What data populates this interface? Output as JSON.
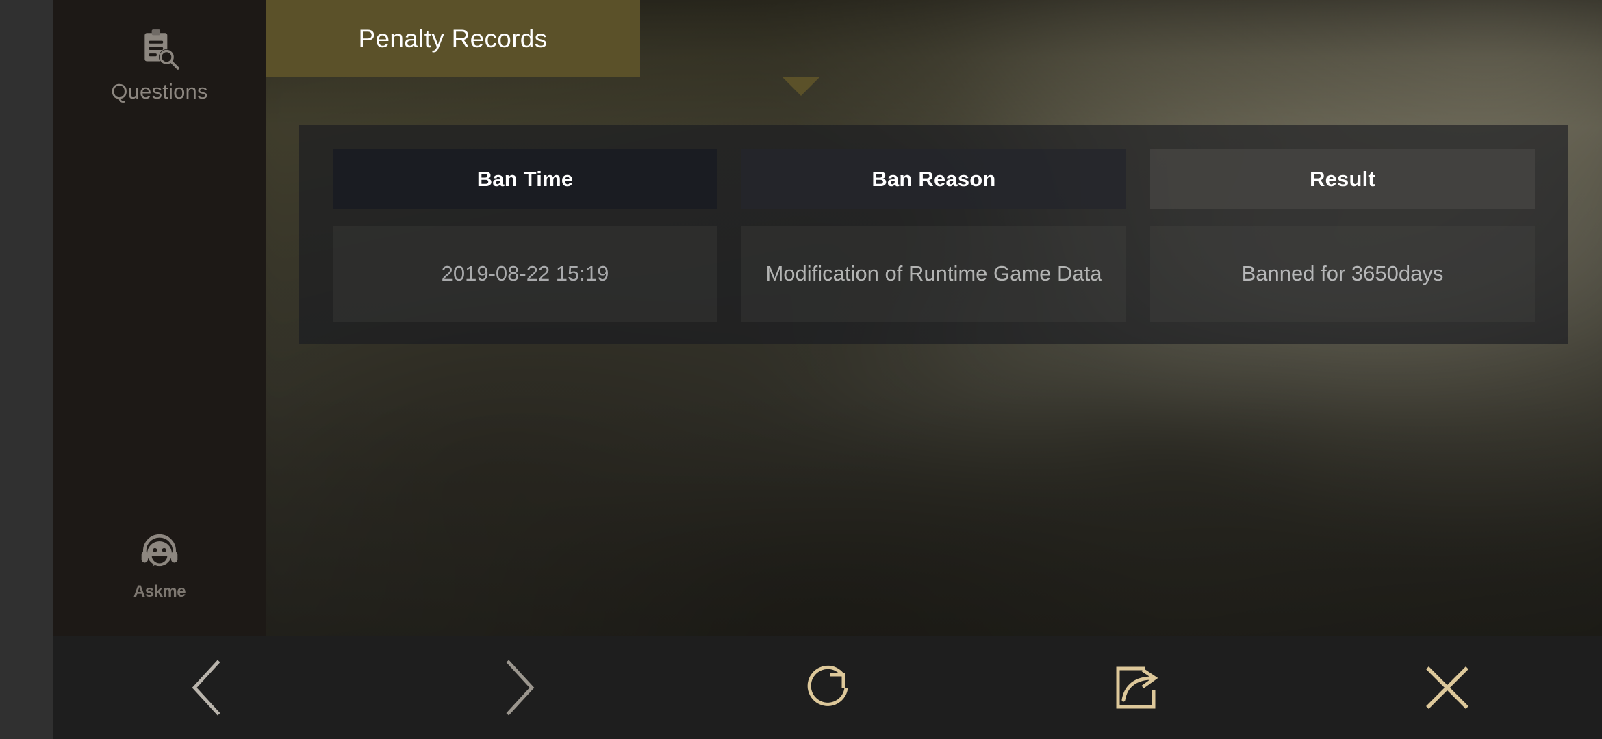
{
  "window": {
    "title": "Penalty Records"
  },
  "sidebar": {
    "items": [
      {
        "id": "questions",
        "icon": "clipboard-search-icon",
        "label": "Questions"
      },
      {
        "id": "askme",
        "icon": "headset-smiley-icon",
        "label": "Askme"
      }
    ]
  },
  "tab": {
    "label": "Penalty Records",
    "color": "#5b5129",
    "text_color": "#ffffff",
    "active": true
  },
  "records_table": {
    "columns": [
      "Ban Time",
      "Ban Reason",
      "Result"
    ],
    "rows": [
      {
        "ban_time": "2019-08-22 15:19",
        "ban_reason": "Modification of Runtime Game Data",
        "result": "Banned for 3650days"
      }
    ]
  },
  "toolbar": {
    "buttons": [
      {
        "id": "back",
        "icon": "chevron-left-icon",
        "label": "Back",
        "color": "#b9b4ac",
        "enabled": true
      },
      {
        "id": "forward",
        "icon": "chevron-right-icon",
        "label": "Forward",
        "color": "#9b968e",
        "enabled": false
      },
      {
        "id": "reload",
        "icon": "refresh-icon",
        "label": "Reload",
        "color": "#ddc89a",
        "enabled": true
      },
      {
        "id": "share",
        "icon": "share-icon",
        "label": "Share",
        "color": "#ddc89a",
        "enabled": true
      },
      {
        "id": "close",
        "icon": "close-icon",
        "label": "Close",
        "color": "#ddc89a",
        "enabled": true
      }
    ]
  },
  "theme": {
    "accent_gold": "#ddc89a",
    "tab_olive": "#5b5129",
    "sidebar_bg": "#1d1916",
    "toolbar_bg": "#1e1e1e",
    "gutter_bg": "#303030",
    "panel_text": "#a9aaac"
  }
}
